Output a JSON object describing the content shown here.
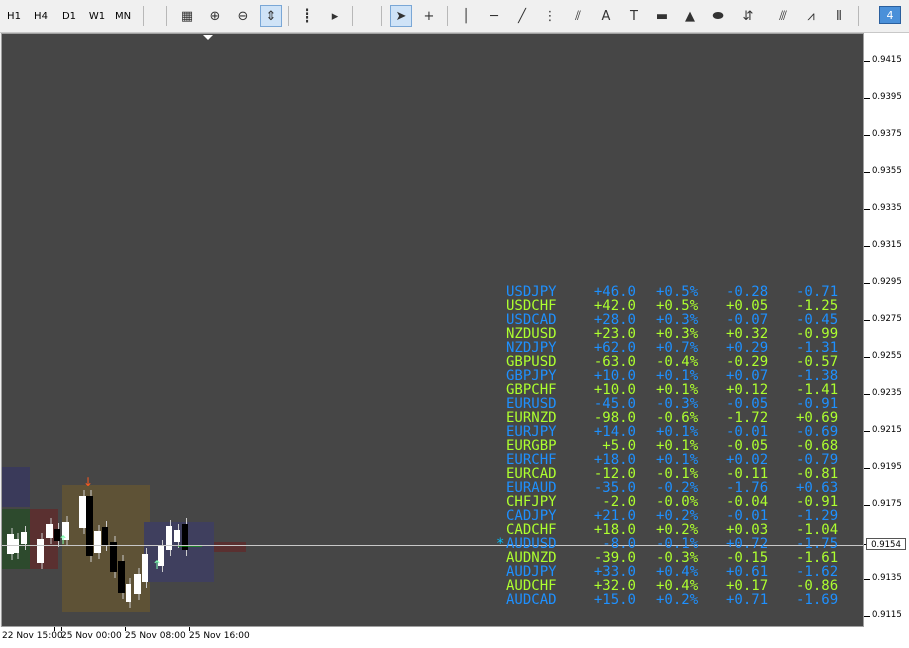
{
  "timeframes": [
    "H1",
    "H4",
    "D1",
    "W1",
    "MN"
  ],
  "tools": [
    {
      "name": "chart-window-icon",
      "glyph": "▦"
    },
    {
      "name": "zoom-in-icon",
      "glyph": "⊕"
    },
    {
      "name": "zoom-out-icon",
      "glyph": "⊖"
    },
    {
      "name": "chart-scale-icon",
      "glyph": "⇕"
    },
    {
      "name": "period-separator-icon",
      "glyph": "┋"
    },
    {
      "name": "autoscroll-icon",
      "glyph": "▸"
    },
    {
      "name": "cursor-icon",
      "glyph": "➤"
    },
    {
      "name": "crosshair-icon",
      "glyph": "+"
    },
    {
      "name": "vertical-line-icon",
      "glyph": "│"
    },
    {
      "name": "horizontal-line-icon",
      "glyph": "─"
    },
    {
      "name": "trendline-icon",
      "glyph": "╱"
    },
    {
      "name": "channel-icon",
      "glyph": "⋮"
    },
    {
      "name": "fibonacci-fan-icon",
      "glyph": "⫽"
    },
    {
      "name": "text-icon",
      "glyph": "A"
    },
    {
      "name": "text-label-icon",
      "glyph": "T"
    },
    {
      "name": "rectangle-icon",
      "glyph": "▬"
    },
    {
      "name": "triangle-icon",
      "glyph": "▲"
    },
    {
      "name": "ellipse-icon",
      "glyph": "⬬"
    },
    {
      "name": "arrows-icon",
      "glyph": "⇵"
    },
    {
      "name": "pitchfork-icon",
      "glyph": "⫻"
    },
    {
      "name": "elliott-wave-icon",
      "glyph": "⩘"
    },
    {
      "name": "cycle-lines-icon",
      "glyph": "⦀"
    }
  ],
  "window_badge": "4",
  "price_axis": {
    "labels": [
      "0.9415",
      "0.9395",
      "0.9375",
      "0.9355",
      "0.9335",
      "0.9315",
      "0.9295",
      "0.9275",
      "0.9255",
      "0.9235",
      "0.9215",
      "0.9195",
      "0.9175",
      "0.9154",
      "0.9135",
      "0.9115"
    ],
    "current_price": "0.9154"
  },
  "time_axis": {
    "labels": [
      "22 Nov 15:00",
      "25 Nov 00:00",
      "25 Nov 08:00",
      "25 Nov 16:00"
    ]
  },
  "colors": {
    "blue": "#1e90ff",
    "yellow": "#adff2f",
    "cyan": "#00bfff"
  },
  "pairs": [
    {
      "pair": "USDJPY",
      "v1": "+46.0",
      "v2": "+0.5%",
      "v3": "-0.28",
      "v4": "-0.71",
      "color": "blue"
    },
    {
      "pair": "USDCHF",
      "v1": "+42.0",
      "v2": "+0.5%",
      "v3": "+0.05",
      "v4": "-1.25",
      "color": "yellow"
    },
    {
      "pair": "USDCAD",
      "v1": "+28.0",
      "v2": "+0.3%",
      "v3": "-0.07",
      "v4": "-0.45",
      "color": "blue"
    },
    {
      "pair": "NZDUSD",
      "v1": "+23.0",
      "v2": "+0.3%",
      "v3": "+0.32",
      "v4": "-0.99",
      "color": "yellow"
    },
    {
      "pair": "NZDJPY",
      "v1": "+62.0",
      "v2": "+0.7%",
      "v3": "+0.29",
      "v4": "-1.31",
      "color": "blue"
    },
    {
      "pair": "GBPUSD",
      "v1": "-63.0",
      "v2": "-0.4%",
      "v3": "-0.29",
      "v4": "-0.57",
      "color": "yellow"
    },
    {
      "pair": "GBPJPY",
      "v1": "+10.0",
      "v2": "+0.1%",
      "v3": "+0.07",
      "v4": "-1.38",
      "color": "blue"
    },
    {
      "pair": "GBPCHF",
      "v1": "+10.0",
      "v2": "+0.1%",
      "v3": "+0.12",
      "v4": "-1.41",
      "color": "yellow"
    },
    {
      "pair": "EURUSD",
      "v1": "-45.0",
      "v2": "-0.3%",
      "v3": "-0.05",
      "v4": "-0.91",
      "color": "blue"
    },
    {
      "pair": "EURNZD",
      "v1": "-98.0",
      "v2": "-0.6%",
      "v3": "-1.72",
      "v4": "+0.69",
      "color": "yellow"
    },
    {
      "pair": "EURJPY",
      "v1": "+14.0",
      "v2": "+0.1%",
      "v3": "-0.01",
      "v4": "-0.69",
      "color": "blue"
    },
    {
      "pair": "EURGBP",
      "v1": "+5.0",
      "v2": "+0.1%",
      "v3": "-0.05",
      "v4": "-0.68",
      "color": "yellow"
    },
    {
      "pair": "EURCHF",
      "v1": "+18.0",
      "v2": "+0.1%",
      "v3": "+0.02",
      "v4": "-0.79",
      "color": "blue"
    },
    {
      "pair": "EURCAD",
      "v1": "-12.0",
      "v2": "-0.1%",
      "v3": "-0.11",
      "v4": "-0.81",
      "color": "yellow"
    },
    {
      "pair": "EURAUD",
      "v1": "-35.0",
      "v2": "-0.2%",
      "v3": "-1.76",
      "v4": "+0.63",
      "color": "blue"
    },
    {
      "pair": "CHFJPY",
      "v1": "-2.0",
      "v2": "-0.0%",
      "v3": "-0.04",
      "v4": "-0.91",
      "color": "yellow"
    },
    {
      "pair": "CADJPY",
      "v1": "+21.0",
      "v2": "+0.2%",
      "v3": "-0.01",
      "v4": "-1.29",
      "color": "blue"
    },
    {
      "pair": "CADCHF",
      "v1": "+18.0",
      "v2": "+0.2%",
      "v3": "+0.03",
      "v4": "-1.04",
      "color": "yellow"
    },
    {
      "pair": "AUDUSD",
      "v1": "-8.0",
      "v2": "-0.1%",
      "v3": "+0.72",
      "v4": "-1.75",
      "color": "blue",
      "marker": "*"
    },
    {
      "pair": "AUDNZD",
      "v1": "-39.0",
      "v2": "-0.3%",
      "v3": "-0.15",
      "v4": "-1.61",
      "color": "yellow"
    },
    {
      "pair": "AUDJPY",
      "v1": "+33.0",
      "v2": "+0.4%",
      "v3": "+0.61",
      "v4": "-1.62",
      "color": "blue"
    },
    {
      "pair": "AUDCHF",
      "v1": "+32.0",
      "v2": "+0.4%",
      "v3": "+0.17",
      "v4": "-0.86",
      "color": "yellow"
    },
    {
      "pair": "AUDCAD",
      "v1": "+15.0",
      "v2": "+0.2%",
      "v3": "+0.71",
      "v4": "-1.69",
      "color": "blue"
    }
  ]
}
